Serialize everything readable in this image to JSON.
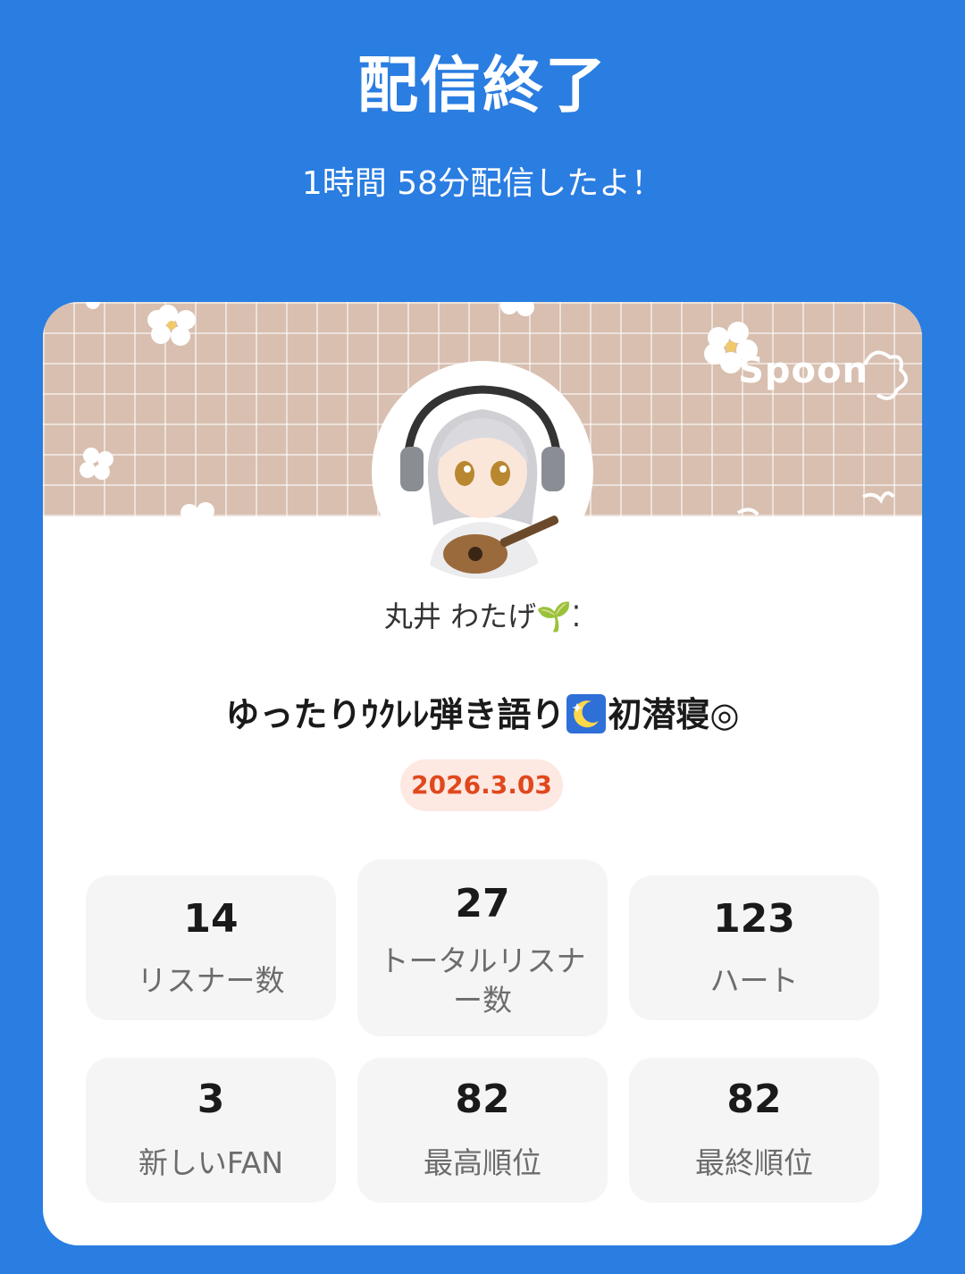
{
  "header": {
    "title": "配信終了",
    "subtitle": "1時間 58分配信したよ！"
  },
  "card": {
    "brand": "Spoon",
    "username": "丸井 わたげ",
    "username_emoji": "🌱⁚",
    "stream_title_pre": "ゆったりｳｸﾚﾚ弾き語り",
    "stream_title_post": "初潜寝◎",
    "date": "2026.3.03",
    "banner_color": "#d8bfb0",
    "date_accent": "#e0481c"
  },
  "stats": [
    {
      "value": "14",
      "label": "リスナー数"
    },
    {
      "value": "27",
      "label_line1": "トータルリスナ",
      "label_line2": "ー数"
    },
    {
      "value": "123",
      "label": "ハート"
    },
    {
      "value": "3",
      "label": "新しいFAN"
    },
    {
      "value": "82",
      "label": "最高順位"
    },
    {
      "value": "82",
      "label": "最終順位"
    }
  ],
  "colors": {
    "background": "#2a7de1",
    "card": "#ffffff",
    "stat_bg": "#f5f5f5"
  }
}
